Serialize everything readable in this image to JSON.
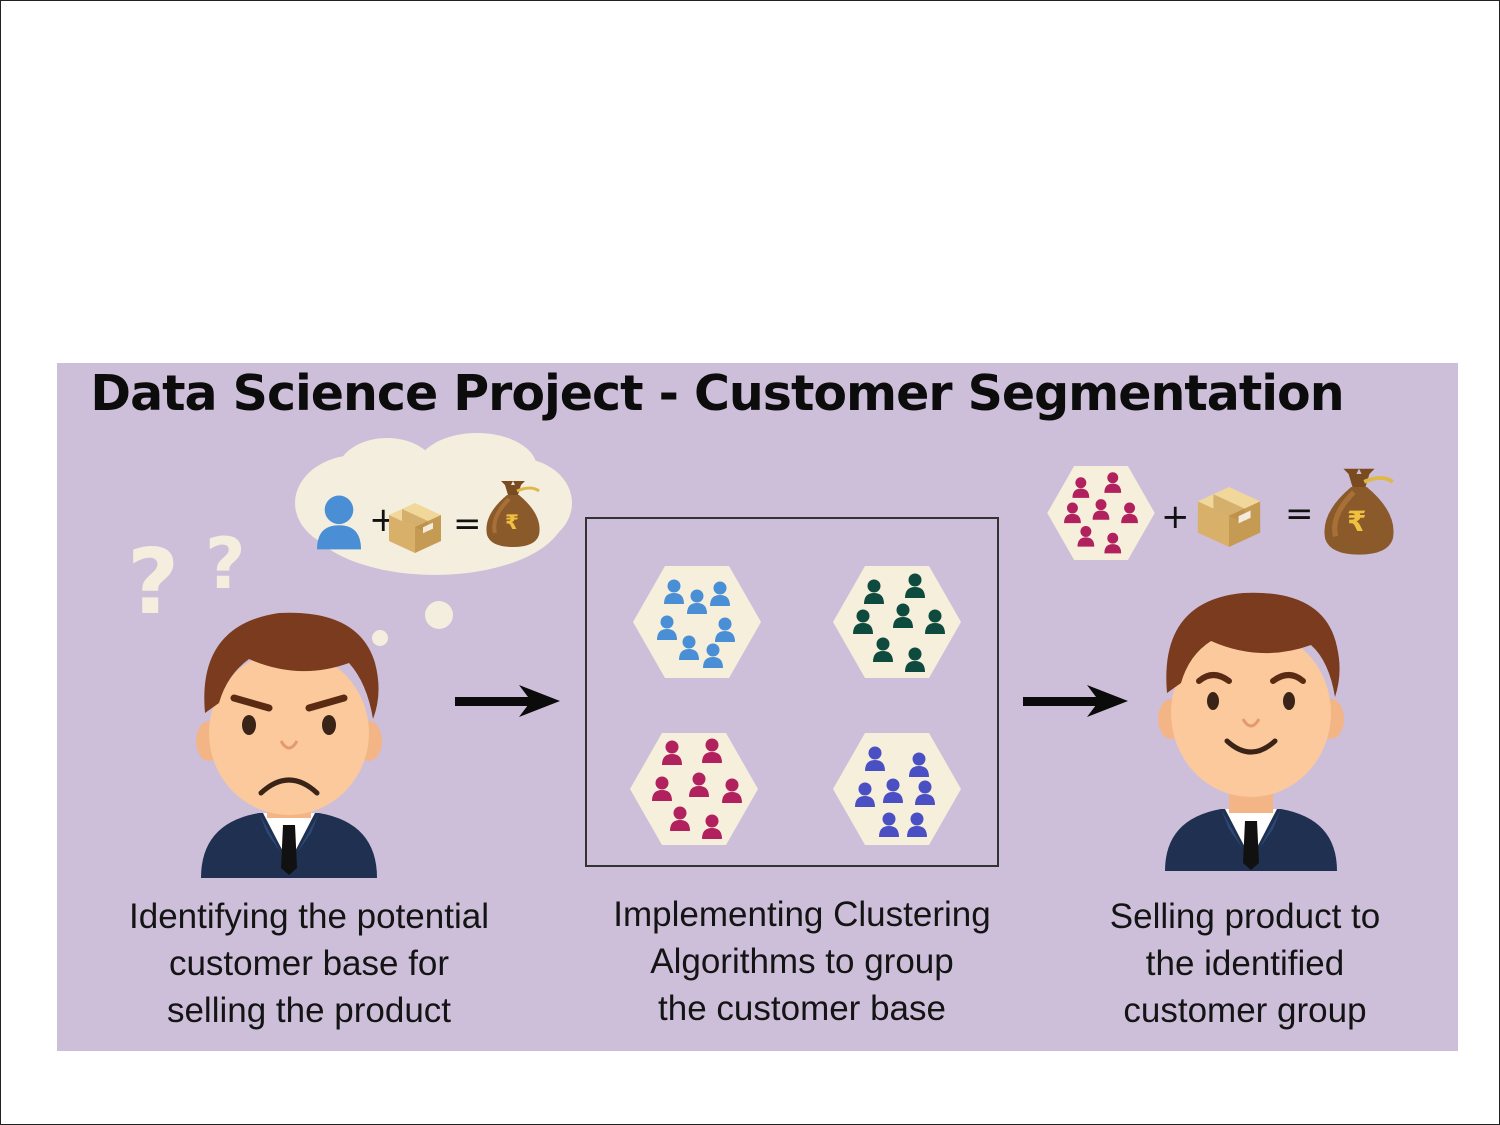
{
  "title": "Data Science Project - Customer Segmentation",
  "steps": [
    {
      "lines": [
        "Identifying the potential",
        "customer base for",
        "selling the product"
      ]
    },
    {
      "lines": [
        "Implementing Clustering",
        "Algorithms to group",
        "the customer base"
      ]
    },
    {
      "lines": [
        "Selling product to",
        "the identified",
        "customer group"
      ]
    }
  ],
  "equation_symbols": {
    "plus": "+",
    "equals": "="
  },
  "currency_symbol": "₹",
  "question_marks": "?",
  "colors": {
    "panel_background": "#cdbfd9",
    "cluster_blue": "#4a8fd6",
    "cluster_teal": "#0f4a3e",
    "cluster_magenta": "#b0215e",
    "cluster_indigo": "#4b4fc4",
    "hexagon_fill": "#f5efdc",
    "money_bag": "#8a5a2b"
  },
  "icons": {
    "left_person": "worried-businessman-icon",
    "right_person": "happy-businessman-icon",
    "thought": "thought-cloud-icon",
    "product": "package-box-icon",
    "money": "money-bag-icon",
    "arrow": "right-arrow-icon",
    "cluster": "customer-cluster-hexagon-icon"
  }
}
